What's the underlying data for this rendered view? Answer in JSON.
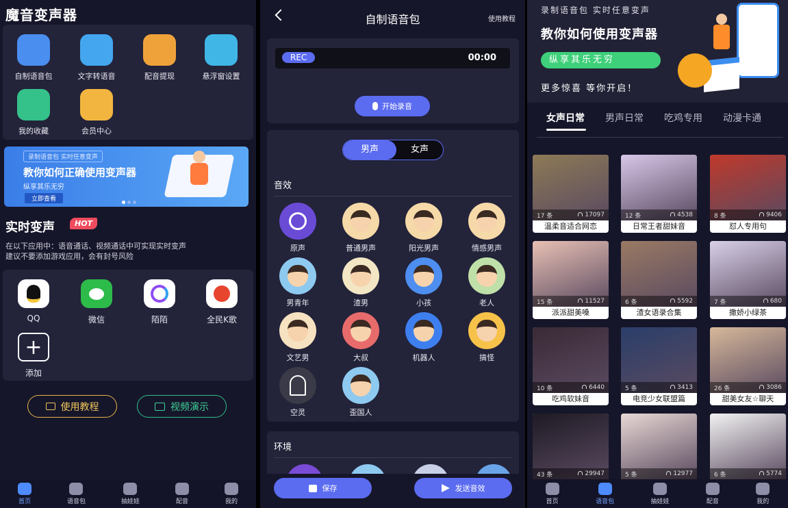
{
  "s1": {
    "title": "魔音变声器",
    "grid": [
      {
        "label": "自制语音包",
        "icon": "planet-icon",
        "color": "#4a8ef0"
      },
      {
        "label": "文字转语音",
        "icon": "text-speech-icon",
        "color": "#43a6ef"
      },
      {
        "label": "配音提现",
        "icon": "wallet-icon",
        "color": "#f0a23a"
      },
      {
        "label": "悬浮窗设置",
        "icon": "hexagon-icon",
        "color": "#3fb6e6"
      },
      {
        "label": "我的收藏",
        "icon": "star-icon",
        "color": "#35c28a"
      },
      {
        "label": "会员中心",
        "icon": "vip-icon",
        "color": "#f2b640"
      }
    ],
    "banner": {
      "tag": "录制语音包  实时任意变声",
      "title": "教你如何正确使用变声器",
      "sub": "纵享其乐无穷",
      "btn": "立即查看"
    },
    "realtime": {
      "title": "实时变声",
      "hot": "HOT",
      "desc1": "在以下应用中：语音通话、视频通话中可实现实时变声",
      "desc2": "建议不要添加游戏应用，会有封号风险"
    },
    "apps": [
      {
        "label": "QQ",
        "icon": "qq-icon",
        "color": "#ffffff"
      },
      {
        "label": "微信",
        "icon": "wechat-icon",
        "color": "#2dbb4a"
      },
      {
        "label": "陌陌",
        "icon": "momo-icon",
        "color": "#ffffff"
      },
      {
        "label": "全民K歌",
        "icon": "ksong-icon",
        "color": "#ffffff"
      },
      {
        "label": "添加",
        "icon": "add-icon",
        "color": "#23233a"
      }
    ],
    "btn_tutorial": "使用教程",
    "btn_video": "视频演示"
  },
  "tabs": [
    {
      "label": "首页",
      "icon": "home-icon"
    },
    {
      "label": "语音包",
      "icon": "mic-icon"
    },
    {
      "label": "抽娃娃",
      "icon": "claw-icon"
    },
    {
      "label": "配音",
      "icon": "dub-icon"
    },
    {
      "label": "我的",
      "icon": "profile-icon"
    }
  ],
  "s2": {
    "title": "自制语音包",
    "help": "使用教程",
    "rec": "REC",
    "time": "00:00",
    "record_btn": "开始录音",
    "toggle_male": "男声",
    "toggle_female": "女声",
    "effects_title": "音效",
    "effects": [
      {
        "label": "原声",
        "icon": "check-icon",
        "color": "#6a4bd6"
      },
      {
        "label": "普通男声",
        "icon": "man-icon",
        "color": "#f6d9a8"
      },
      {
        "label": "阳光男声",
        "icon": "man-glasses-icon",
        "color": "#f6d9a8"
      },
      {
        "label": "情感男声",
        "icon": "man-icon",
        "color": "#f6d9a8"
      },
      {
        "label": "男青年",
        "icon": "young-man-icon",
        "color": "#8ec9f0"
      },
      {
        "label": "渣男",
        "icon": "man-icon",
        "color": "#f2e6c4"
      },
      {
        "label": "小孩",
        "icon": "kid-icon",
        "color": "#4d8ef0"
      },
      {
        "label": "老人",
        "icon": "old-man-icon",
        "color": "#bfe0a8"
      },
      {
        "label": "文艺男",
        "icon": "man-icon",
        "color": "#f6e2c0"
      },
      {
        "label": "大叔",
        "icon": "uncle-icon",
        "color": "#e76b6b"
      },
      {
        "label": "机器人",
        "icon": "robot-icon",
        "color": "#3e7ff0"
      },
      {
        "label": "搞怪",
        "icon": "funny-face-icon",
        "color": "#f6c24a"
      },
      {
        "label": "空灵",
        "icon": "ghost-icon",
        "color": "#3a3a48"
      },
      {
        "label": "歪国人",
        "icon": "foreigner-icon",
        "color": "#8ec9f0"
      }
    ],
    "env_title": "环境",
    "save": "保存",
    "send": "发送音效"
  },
  "s3": {
    "banner": {
      "tag": "录制语音包  实时任意变声",
      "title": "教你如何使用变声器",
      "sub": "纵享其乐无穷",
      "more": "更多惊喜  等你开启！"
    },
    "categories": [
      "女声日常",
      "男声日常",
      "吃鸡专用",
      "动漫卡通"
    ],
    "packs": [
      {
        "count": "17 条",
        "plays": "17097",
        "name": "温柔音适合网恋",
        "color": "#8d7a56"
      },
      {
        "count": "12 条",
        "plays": "4538",
        "name": "日常王者甜妹音",
        "color": "#d8c6e8"
      },
      {
        "count": "8 条",
        "plays": "9406",
        "name": "怼人专用句",
        "color": "#c0392b"
      },
      {
        "count": "15 条",
        "plays": "11527",
        "name": "派派甜美嗓",
        "color": "#e8c0b4"
      },
      {
        "count": "6 条",
        "plays": "5592",
        "name": "渣女语录合集",
        "color": "#9a7a64"
      },
      {
        "count": "7 条",
        "plays": "680",
        "name": "撒娇小绿茶",
        "color": "#d8d0e8"
      },
      {
        "count": "10 条",
        "plays": "6440",
        "name": "吃鸡软妹音",
        "color": "#3a2a36"
      },
      {
        "count": "5 条",
        "plays": "3413",
        "name": "电竞少女联盟篇",
        "color": "#2a3e6a"
      },
      {
        "count": "26 条",
        "plays": "3086",
        "name": "甜美女友☆聊天",
        "color": "#d6b89a"
      },
      {
        "count": "43 条",
        "plays": "29947",
        "name": "",
        "color": "#1e1a24"
      },
      {
        "count": "5 条",
        "plays": "12977",
        "name": "",
        "color": "#e8d8d4"
      },
      {
        "count": "6 条",
        "plays": "5774",
        "name": "",
        "color": "#f2f2f2"
      }
    ]
  }
}
